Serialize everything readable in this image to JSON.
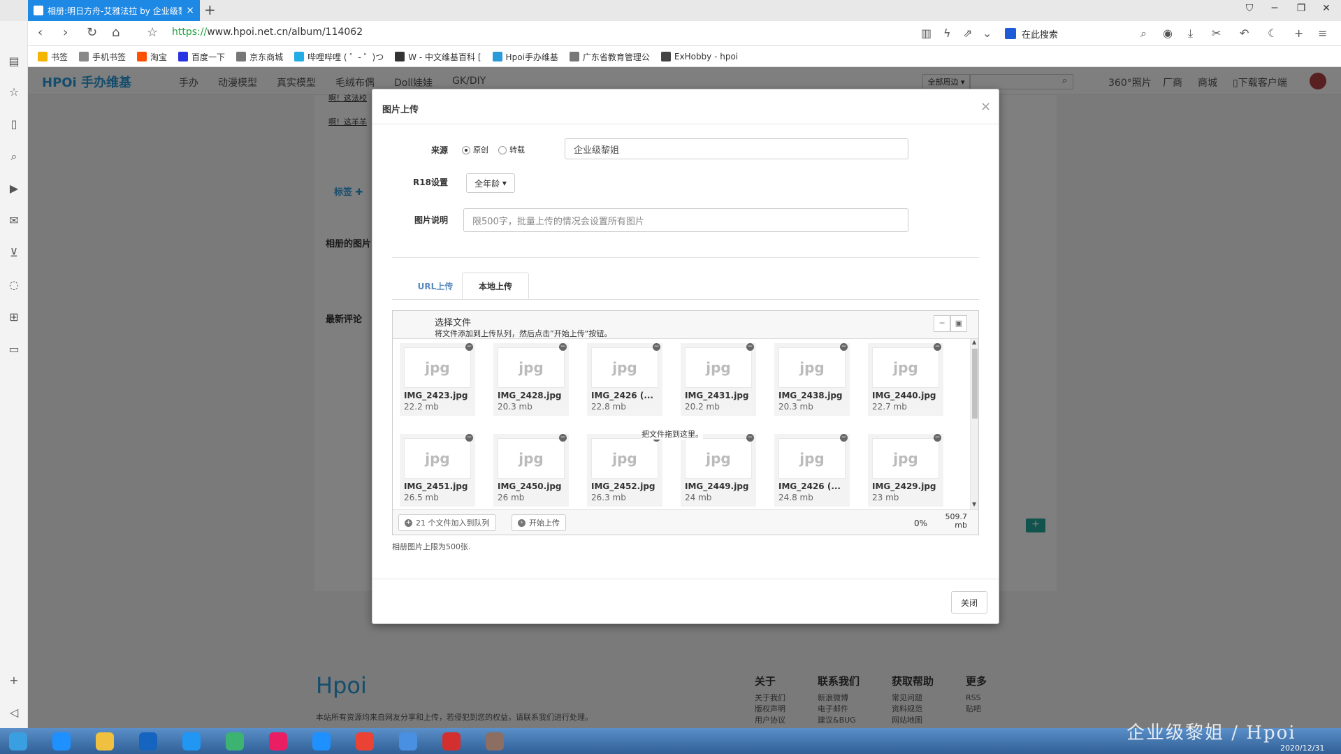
{
  "browser": {
    "tab_title": "相册:明日方舟-艾雅法拉 by 企业级黎",
    "new_tab": "+",
    "url_proto": "https://",
    "url_rest": "www.hpoi.net.cn/album/114062",
    "search_placeholder": "在此搜索",
    "bookmarks": [
      {
        "label": "书签",
        "color": "#f4b400"
      },
      {
        "label": "手机书签",
        "color": "#888888"
      },
      {
        "label": "淘宝",
        "color": "#ff5000"
      },
      {
        "label": "百度一下",
        "color": "#2932e1"
      },
      {
        "label": "京东商城",
        "color": "#777777"
      },
      {
        "label": "哔哩哔哩 ( ゜- ゜)つ",
        "color": "#23ade5"
      },
      {
        "label": "W - 中文维基百科 [",
        "color": "#333333"
      },
      {
        "label": "Hpoi手办维基",
        "color": "#2a9ad8"
      },
      {
        "label": "广东省教育管理公",
        "color": "#777777"
      },
      {
        "label": "ExHobby - hpoi",
        "color": "#444444"
      }
    ]
  },
  "site": {
    "logo": "HPOi 手办维基",
    "nav": [
      "手办",
      "动漫模型",
      "真实模型",
      "毛绒布偶",
      "Doll娃娃",
      "GK/DIY"
    ],
    "header_right": [
      "全部周边",
      "360°照片",
      "厂商",
      "商城",
      "下载客户端"
    ],
    "bg_links": [
      "啊！这法校",
      "啊！这羊羊"
    ],
    "tags_label": "标签",
    "section_album_images": "相册的图片",
    "section_latest_comments": "最新评论",
    "footer_logo": "Hpoi",
    "footer_text": "本站所有资源均来自网友分享和上传，若侵犯到您的权益，请联系我们进行处理。",
    "footer_cols": [
      {
        "title": "关于",
        "items": [
          "关于我们",
          "版权声明",
          "用户协议"
        ]
      },
      {
        "title": "联系我们",
        "items": [
          "新浪微博",
          "电子邮件",
          "建议&BUG"
        ]
      },
      {
        "title": "获取帮助",
        "items": [
          "常见问题",
          "资料规范",
          "网站地图"
        ]
      },
      {
        "title": "更多",
        "items": [
          "RSS",
          "贴吧"
        ]
      }
    ]
  },
  "modal": {
    "title": "图片上传",
    "close_x": "×",
    "source_label": "来源",
    "source_options": [
      "原创",
      "转载"
    ],
    "source_selected": "原创",
    "source_value": "企业级黎姐",
    "r18_label": "R18设置",
    "r18_value": "全年龄",
    "desc_label": "图片说明",
    "desc_placeholder": "限500字，批量上传的情况会设置所有图片",
    "tab_url": "URL上传",
    "tab_local": "本地上传",
    "uploader": {
      "title": "选择文件",
      "subtitle": "将文件添加到上传队列，然后点击”开始上传“按钮。",
      "drop_hint": "把文件拖到这里。",
      "files": [
        {
          "ext": "jpg",
          "name": "IMG_2423.jpg",
          "size": "22.2 mb"
        },
        {
          "ext": "jpg",
          "name": "IMG_2428.jpg",
          "size": "20.3 mb"
        },
        {
          "ext": "jpg",
          "name": "IMG_2426 (...",
          "size": "22.8 mb"
        },
        {
          "ext": "jpg",
          "name": "IMG_2431.jpg",
          "size": "20.2 mb"
        },
        {
          "ext": "jpg",
          "name": "IMG_2438.jpg",
          "size": "20.3 mb"
        },
        {
          "ext": "jpg",
          "name": "IMG_2440.jpg",
          "size": "22.7 mb"
        },
        {
          "ext": "jpg",
          "name": "IMG_2451.jpg",
          "size": "26.5 mb"
        },
        {
          "ext": "jpg",
          "name": "IMG_2450.jpg",
          "size": "26 mb"
        },
        {
          "ext": "jpg",
          "name": "IMG_2452.jpg",
          "size": "26.3 mb"
        },
        {
          "ext": "jpg",
          "name": "IMG_2449.jpg",
          "size": "24 mb"
        },
        {
          "ext": "jpg",
          "name": "IMG_2426 (...",
          "size": "24.8 mb"
        },
        {
          "ext": "jpg",
          "name": "IMG_2429.jpg",
          "size": "23 mb"
        }
      ],
      "queue_btn": "21 个文件加入到队列",
      "start_btn": "开始上传",
      "percent": "0%",
      "total_size_num": "509.7",
      "total_size_unit": "mb"
    },
    "limit_note": "相册图片上限为500张.",
    "close_btn": "关闭"
  },
  "taskbar": {
    "clock_date": "2020/12/31",
    "watermark": "企业级黎姐 / Hpoi",
    "apps": [
      {
        "name": "start",
        "color": "#3a9fe0"
      },
      {
        "name": "ie",
        "color": "#1e90ff"
      },
      {
        "name": "explorer",
        "color": "#f0c040"
      },
      {
        "name": "kugou",
        "color": "#1565c0"
      },
      {
        "name": "browser360",
        "color": "#2196f3"
      },
      {
        "name": "player",
        "color": "#3cb371"
      },
      {
        "name": "youku",
        "color": "#e91e63"
      },
      {
        "name": "ie2",
        "color": "#1e90ff"
      },
      {
        "name": "chrome",
        "color": "#ea4335"
      },
      {
        "name": "baidu-netdisk",
        "color": "#4a90e2"
      },
      {
        "name": "netease-music",
        "color": "#d32f2f"
      },
      {
        "name": "avatar-app",
        "color": "#8d6e63"
      }
    ]
  }
}
